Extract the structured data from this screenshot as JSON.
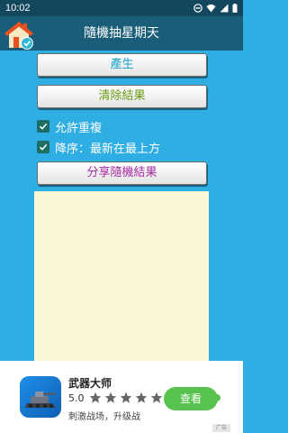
{
  "status_bar": {
    "time": "10:02"
  },
  "app_bar": {
    "title": "隨機抽星期天"
  },
  "buttons": {
    "generate": "產生",
    "clear": "清除結果",
    "share": "分享隨機結果"
  },
  "options": {
    "allow_repeat": {
      "label": "允許重複",
      "checked": true
    },
    "descending": {
      "label": "降序：最新在最上方",
      "checked": true
    }
  },
  "result_area": {
    "content": ""
  },
  "ad": {
    "title": "武器大师",
    "rating": "5.0",
    "stars": 5,
    "description": "刺激战场，升级战",
    "cta": "查看",
    "label": "广告"
  },
  "colors": {
    "app_bar": "#1a5d79",
    "status_bar": "#12475e",
    "background": "#2eaee3",
    "result_bg": "#faf7d4",
    "generate_text": "#16a2c8",
    "clear_text": "#6a9b12",
    "share_text": "#a42ba0",
    "cta": "#58c24e"
  }
}
